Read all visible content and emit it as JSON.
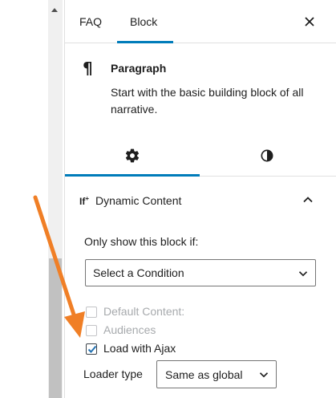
{
  "tabs": {
    "faq": "FAQ",
    "block": "Block"
  },
  "block": {
    "icon": "¶",
    "title": "Paragraph",
    "description": "Start with the basic building block of all narrative."
  },
  "settings_tabs": [
    "gear-icon",
    "contrast-icon"
  ],
  "panel": {
    "icon_text": "If",
    "icon_sup": "+",
    "title": "Dynamic Content",
    "condition_label": "Only show this block if:",
    "condition_select": "Select a Condition",
    "checkboxes": [
      {
        "label": "Default Content:",
        "checked": false,
        "disabled": true
      },
      {
        "label": "Audiences",
        "checked": false,
        "disabled": true
      },
      {
        "label": "Load with Ajax",
        "checked": true,
        "disabled": false
      }
    ],
    "loader_label": "Loader type",
    "loader_select": "Same as global"
  },
  "colors": {
    "accent": "#007cba",
    "arrow": "#f07f26",
    "scroll_thumb": "#c1c1c1"
  }
}
